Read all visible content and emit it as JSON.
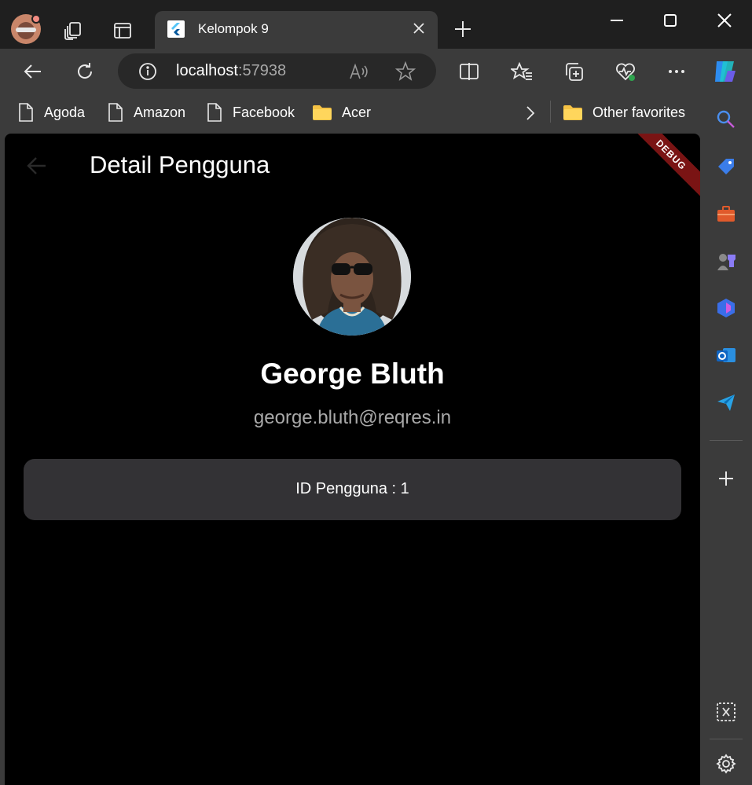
{
  "tab": {
    "title": "Kelompok 9"
  },
  "address": {
    "host": "localhost",
    "port": ":57938"
  },
  "favorites": [
    {
      "label": "Agoda",
      "icon": "page-icon"
    },
    {
      "label": "Amazon",
      "icon": "page-icon"
    },
    {
      "label": "Facebook",
      "icon": "page-icon"
    },
    {
      "label": "Acer",
      "icon": "folder-icon"
    }
  ],
  "other_favorites": {
    "label": "Other favorites"
  },
  "app": {
    "title": "Detail Pengguna",
    "debug_banner": "DEBUG",
    "user": {
      "name": "George Bluth",
      "email": "george.bluth@reqres.in",
      "id_label": "ID Pengguna : 1"
    }
  },
  "sidebar_icons": [
    "search-icon",
    "tag-icon",
    "toolbox-icon",
    "games-icon",
    "copilot-icon",
    "outlook-icon",
    "send-icon",
    "add-icon",
    "screenshot-icon",
    "settings-icon"
  ],
  "colors": {
    "accent_ribbon": "#7a1414",
    "card": "#333235",
    "email": "#a9a9a9"
  }
}
